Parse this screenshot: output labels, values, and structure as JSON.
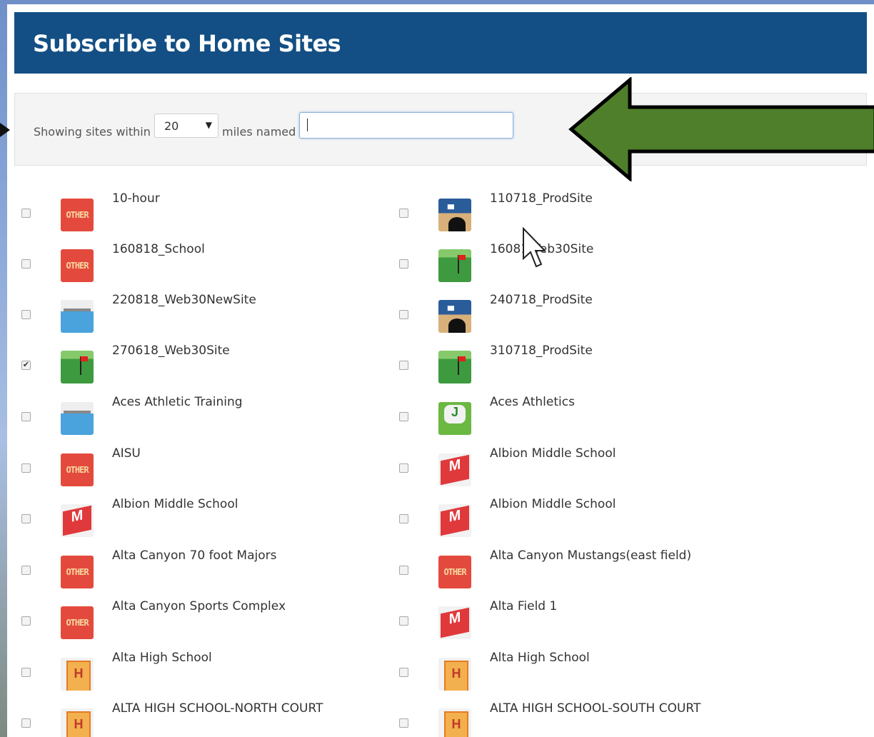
{
  "header": {
    "title": "Subscribe to Home Sites"
  },
  "filter": {
    "showing_label": "Showing sites within",
    "distance_value": "20",
    "miles_label": "miles named",
    "search_value": ""
  },
  "annotation_arrow_color": "#4f7f2a",
  "sites_left": [
    {
      "name": "10-hour",
      "icon": "other-icon",
      "checked": false
    },
    {
      "name": "160818_School",
      "icon": "other-icon",
      "checked": false
    },
    {
      "name": "220818_Web30NewSite",
      "icon": "pool-icon",
      "checked": false
    },
    {
      "name": "270618_Web30Site",
      "icon": "golf-icon",
      "checked": true
    },
    {
      "name": "Aces Athletic Training",
      "icon": "pool-icon",
      "checked": false
    },
    {
      "name": "AISU",
      "icon": "other-icon",
      "checked": false
    },
    {
      "name": "Albion Middle School",
      "icon": "middle-school-icon",
      "checked": false
    },
    {
      "name": "Alta Canyon 70 foot Majors",
      "icon": "other-icon",
      "checked": false
    },
    {
      "name": "Alta Canyon Sports Complex",
      "icon": "other-icon",
      "checked": false
    },
    {
      "name": "Alta High School",
      "icon": "high-school-icon",
      "checked": false
    },
    {
      "name": "ALTA HIGH SCHOOL-NORTH COURT",
      "icon": "high-school-icon",
      "checked": false
    }
  ],
  "sites_right": [
    {
      "name": "110718_ProdSite",
      "icon": "bowling-icon",
      "checked": false
    },
    {
      "name": "16081   Veb30Site",
      "icon": "golf-icon",
      "checked": false
    },
    {
      "name": "240718_ProdSite",
      "icon": "bowling-icon",
      "checked": false
    },
    {
      "name": "310718_ProdSite",
      "icon": "golf-icon",
      "checked": false
    },
    {
      "name": "Aces Athletics",
      "icon": "track-icon",
      "checked": false
    },
    {
      "name": "Albion Middle School",
      "icon": "middle-school-icon",
      "checked": false
    },
    {
      "name": "Albion Middle School",
      "icon": "middle-school-icon",
      "checked": false
    },
    {
      "name": "Alta Canyon Mustangs(east field)",
      "icon": "other-icon",
      "checked": false
    },
    {
      "name": "Alta Field 1",
      "icon": "middle-school-icon",
      "checked": false
    },
    {
      "name": "Alta High School",
      "icon": "high-school-icon",
      "checked": false
    },
    {
      "name": "ALTA HIGH SCHOOL-SOUTH COURT",
      "icon": "high-school-icon",
      "checked": false
    }
  ],
  "icon_text": {
    "other": "OTHER"
  }
}
